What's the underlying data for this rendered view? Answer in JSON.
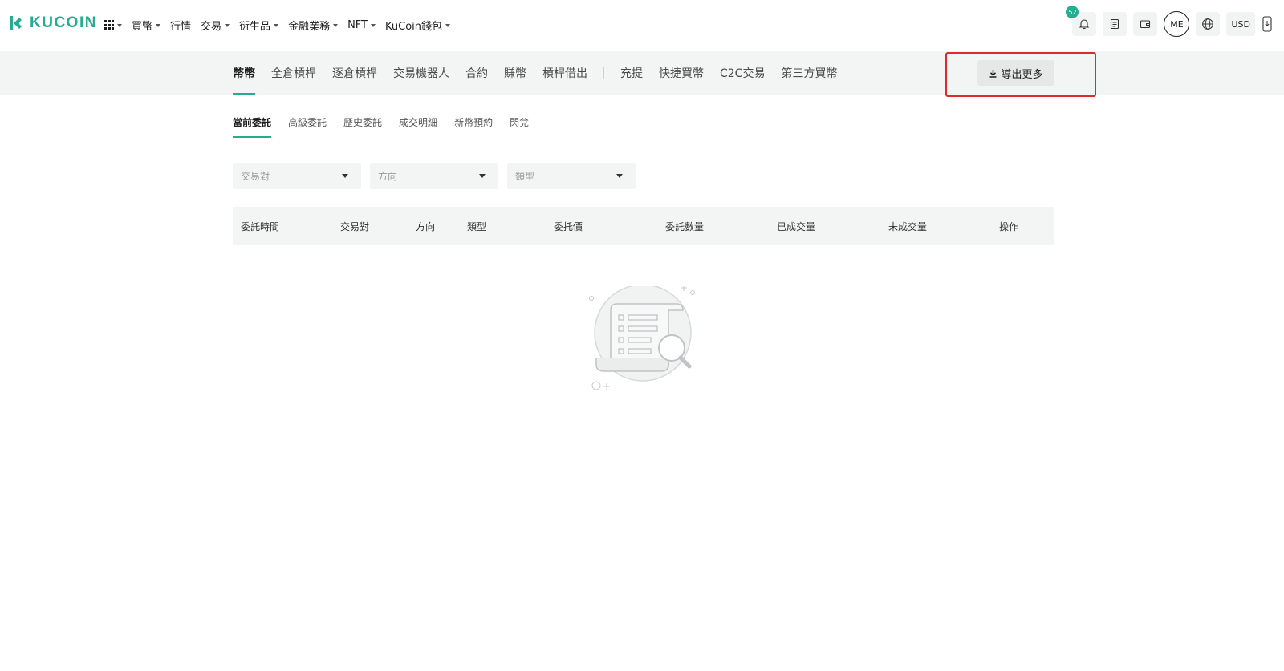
{
  "brand": {
    "name": "KUCOIN",
    "color": "#24ae8f"
  },
  "nav": {
    "items": [
      {
        "label": "買幣",
        "dropdown": true
      },
      {
        "label": "行情",
        "dropdown": false
      },
      {
        "label": "交易",
        "dropdown": true
      },
      {
        "label": "衍生品",
        "dropdown": true
      },
      {
        "label": "金融業務",
        "dropdown": true
      },
      {
        "label": "NFT",
        "dropdown": true
      },
      {
        "label": "KuCoin錢包",
        "dropdown": true
      }
    ]
  },
  "header_right": {
    "notification_count": "52",
    "avatar_initials": "ME",
    "currency": "USD"
  },
  "tabs": {
    "group1": [
      "幣幣",
      "全倉槓桿",
      "逐倉槓桿",
      "交易機器人",
      "合約",
      "賺幣",
      "槓桿借出"
    ],
    "group2": [
      "充提",
      "快捷買幣",
      "C2C交易",
      "第三方買幣"
    ],
    "active": "幣幣",
    "export_label": "導出更多"
  },
  "subtabs": {
    "items": [
      "當前委託",
      "高級委託",
      "歷史委託",
      "成交明細",
      "新幣預約",
      "閃兌"
    ],
    "active": "當前委託"
  },
  "filters": {
    "pair_placeholder": "交易對",
    "side_placeholder": "方向",
    "type_placeholder": "類型"
  },
  "table": {
    "columns": [
      "委託時間",
      "交易對",
      "方向",
      "類型",
      "委托價",
      "委託數量",
      "已成交量",
      "未成交量",
      "操作"
    ],
    "rows": []
  },
  "colors": {
    "accent": "#24ae8f",
    "highlight": "#e02a2a",
    "panel_bg": "#f3f4f4"
  }
}
